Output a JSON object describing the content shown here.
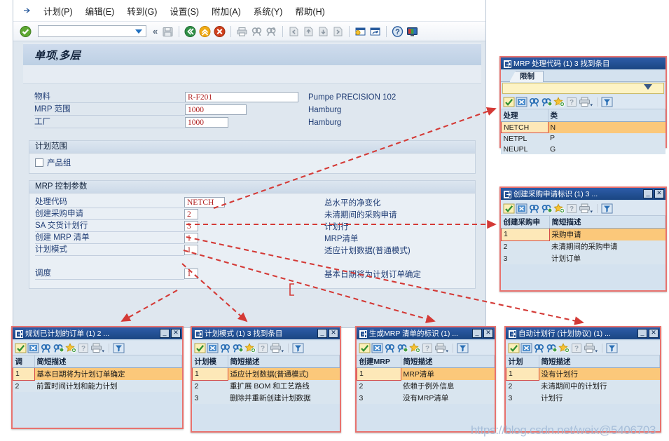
{
  "app": {
    "menu": [
      "计划(P)",
      "编辑(E)",
      "转到(G)",
      "设置(S)",
      "附加(A)",
      "系统(Y)",
      "帮助(H)"
    ],
    "command_field_value": "",
    "toolbar_icons": [
      "enter-green-check-icon",
      "back-green-icon",
      "exit-yellow-icon",
      "cancel-red-icon",
      "print-icon",
      "find-icon",
      "find-next-icon",
      "first-page-icon",
      "previous-page-icon",
      "next-page-icon",
      "last-page-icon",
      "create-session-icon",
      "create-shortcut-icon",
      "help-icon",
      "customize-local-layout-icon"
    ]
  },
  "screen": {
    "title": "单项,多层",
    "material": {
      "label": "物料",
      "value": "R-F201",
      "desc": "Pumpe PRECISION 102"
    },
    "mrp_area": {
      "label": "MRP 范围",
      "value": "1000",
      "desc": "Hamburg"
    },
    "plant": {
      "label": "工厂",
      "value": "1000",
      "desc": "Hamburg"
    },
    "planning_scope": {
      "header": "计划范围",
      "checkbox_label": "产品组",
      "checked": false
    },
    "mrp_control": {
      "header": "MRP 控制参数",
      "rows": [
        {
          "label": "处理代码",
          "value": "NETCH",
          "desc": "总水平的净变化"
        },
        {
          "label": "创建采购申请",
          "value": "2",
          "desc": "未清期间的采购申请"
        },
        {
          "label": "SA 交货计划行",
          "value": "3",
          "desc": "计划行"
        },
        {
          "label": "创建 MRP 清单",
          "value": "1",
          "desc": "MRP清单"
        },
        {
          "label": "计划模式",
          "value": "1",
          "desc": "适应计划数据(普通模式)"
        },
        {
          "label": "调度",
          "value": "1",
          "desc": "基本日期将为计划订单确定"
        }
      ]
    }
  },
  "popups": [
    {
      "id": "mrp-processing-key",
      "title": "MRP 处理代码 (1)   3 找到条目",
      "has_tab": true,
      "tab_label": "限制",
      "has_restrict_bar": true,
      "has_window_buttons": false,
      "columns": [
        "处理",
        "类"
      ],
      "rows": [
        {
          "key": "NETCH",
          "desc": "N",
          "selected": true
        },
        {
          "key": "NETPL",
          "desc": "P",
          "selected": false
        },
        {
          "key": "NEUPL",
          "desc": "G",
          "selected": false
        }
      ]
    },
    {
      "id": "create-pr-indicator",
      "title": "创建采购申请标识 (1)   3 ...",
      "has_tab": false,
      "has_restrict_bar": false,
      "has_window_buttons": true,
      "columns": [
        "创建采购申",
        "简短描述"
      ],
      "rows": [
        {
          "key": "1",
          "desc": "采购申请",
          "selected": true
        },
        {
          "key": "2",
          "desc": "未清期间的采购申请",
          "selected": false
        },
        {
          "key": "3",
          "desc": "计划订单",
          "selected": false
        }
      ]
    },
    {
      "id": "scheduling-planned-orders",
      "title": "规划已计划的订单 (1)   2 ...",
      "has_tab": false,
      "has_restrict_bar": false,
      "has_window_buttons": true,
      "columns": [
        "调",
        "简短描述"
      ],
      "rows": [
        {
          "key": "1",
          "desc": "基本日期将为计划订单确定",
          "selected": true
        },
        {
          "key": "2",
          "desc": "前置时间计划和能力计划",
          "selected": false
        }
      ]
    },
    {
      "id": "planning-mode",
      "title": "计划模式 (1)   3 找到条目",
      "has_tab": false,
      "has_restrict_bar": false,
      "has_window_buttons": true,
      "columns": [
        "计划模",
        "简短描述"
      ],
      "rows": [
        {
          "key": "1",
          "desc": "适应计划数据(普通模式)",
          "selected": true
        },
        {
          "key": "2",
          "desc": "重扩展 BOM 和工艺路线",
          "selected": false
        },
        {
          "key": "3",
          "desc": "删除并重新创建计划数据",
          "selected": false
        }
      ]
    },
    {
      "id": "create-mrp-list",
      "title": "生成MRP 清单的标识 (1)   ...",
      "has_tab": false,
      "has_restrict_bar": false,
      "has_window_buttons": true,
      "columns": [
        "创建MRP",
        "简短描述"
      ],
      "rows": [
        {
          "key": "1",
          "desc": "MRP清单",
          "selected": true
        },
        {
          "key": "2",
          "desc": "依赖于例外信息",
          "selected": false
        },
        {
          "key": "3",
          "desc": "没有MRP清单",
          "selected": false
        }
      ]
    },
    {
      "id": "automatic-schedule-lines",
      "title": "自动计划行 (计划协议) (1)   ...",
      "has_tab": false,
      "has_restrict_bar": false,
      "has_window_buttons": true,
      "columns": [
        "计划",
        "简短描述"
      ],
      "rows": [
        {
          "key": "1",
          "desc": "没有计划行",
          "selected": true
        },
        {
          "key": "2",
          "desc": "未清期间中的计划行",
          "selected": false
        },
        {
          "key": "3",
          "desc": "计划行",
          "selected": false
        }
      ]
    }
  ],
  "watermark": "https://blog.csdn.net/weix@5406703",
  "colors": {
    "annotation_red": "#d43a36",
    "popup_title_blue": "#1a4682",
    "selection_orange": "#fbc87a",
    "field_text_red": "#b02020",
    "label_blue": "#1f3c74"
  }
}
